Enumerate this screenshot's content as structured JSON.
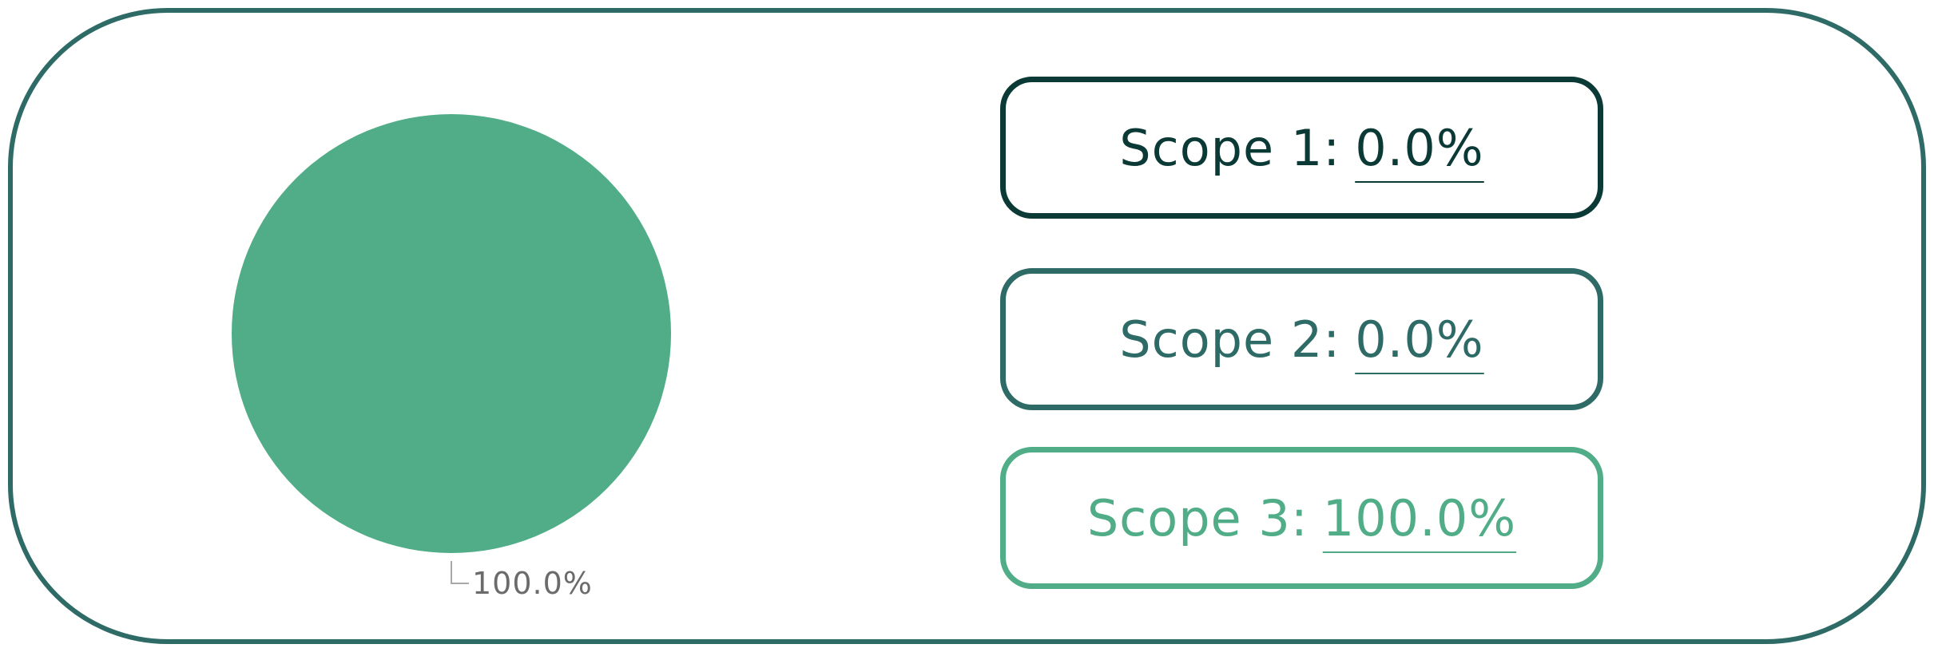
{
  "colors": {
    "frame": "#2f6b66",
    "scope1": "#0b3a36",
    "scope2": "#2f6b66",
    "scope3": "#50ad87",
    "label_text": "#6b6b6b",
    "leader_line": "#a8a8a8"
  },
  "scopes": [
    {
      "label": "Scope 1:",
      "value": "0.0%"
    },
    {
      "label": "Scope 2:",
      "value": "0.0%"
    },
    {
      "label": "Scope 3:",
      "value": "100.0%"
    }
  ],
  "chart_data": {
    "type": "pie",
    "title": "",
    "slices": [
      {
        "name": "Scope 1",
        "value": 0.0,
        "color": "#0b3a36"
      },
      {
        "name": "Scope 2",
        "value": 0.0,
        "color": "#2f6b66"
      },
      {
        "name": "Scope 3",
        "value": 100.0,
        "color": "#50ad87"
      }
    ],
    "data_labels": [
      "100.0%"
    ],
    "legend": "none"
  }
}
